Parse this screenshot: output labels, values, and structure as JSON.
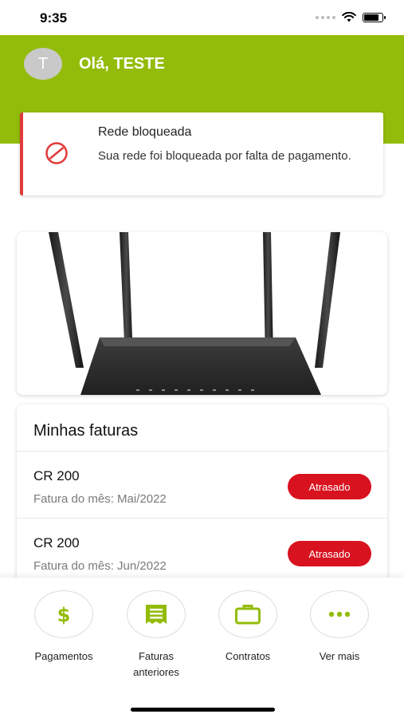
{
  "status_bar": {
    "time": "9:35"
  },
  "header": {
    "avatar_initial": "T",
    "greeting": "Olá, TESTE",
    "bg_color": "#93bc0a"
  },
  "alert": {
    "title": "Rede bloqueada",
    "message": "Sua rede foi bloqueada por falta de pagamento.",
    "icon": "blocked-icon",
    "accent_color": "#e03a3a"
  },
  "banner": {
    "image": "router-image"
  },
  "invoices": {
    "title": "Minhas faturas",
    "items": [
      {
        "name": "CR 200",
        "subtitle": "Fatura do mês: Mai/2022",
        "status": "Atrasado"
      },
      {
        "name": "CR 200",
        "subtitle": "Fatura do mês: Jun/2022",
        "status": "Atrasado"
      }
    ],
    "status_color": "#d8121f"
  },
  "actions": [
    {
      "label": "Pagamentos",
      "icon": "dollar-icon"
    },
    {
      "label": "Faturas\nanteriores",
      "icon": "receipt-icon"
    },
    {
      "label": "Contratos",
      "icon": "briefcase-icon"
    },
    {
      "label": "Ver mais",
      "icon": "more-icon"
    }
  ]
}
